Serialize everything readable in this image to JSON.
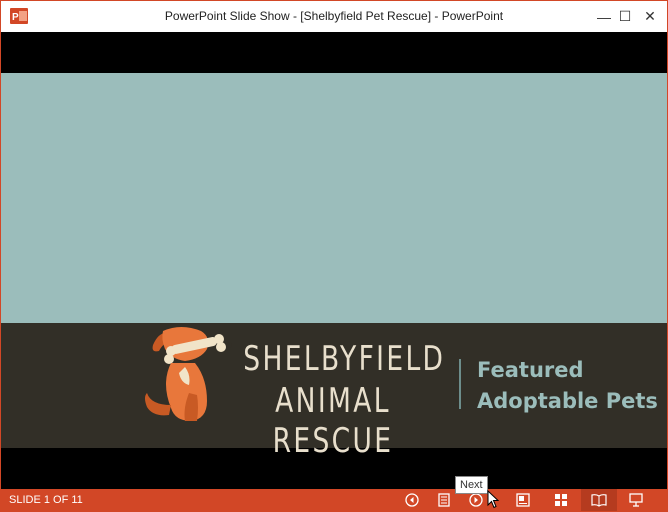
{
  "window": {
    "title": "PowerPoint Slide Show - [Shelbyfield Pet Rescue] - PowerPoint",
    "app_icon_letter": "P",
    "minimize_glyph": "—",
    "maximize_glyph": "☐",
    "close_glyph": "✕"
  },
  "slide": {
    "org_line1": "SHELBYFIELD",
    "org_line2": "ANIMAL RESCUE",
    "tag_line1": "Featured",
    "tag_line2": "Adoptable Pets",
    "colors": {
      "background": "#9bbdbb",
      "band": "#322f27",
      "dog": "#e8773b",
      "org_text": "#e8dfcc",
      "tag_text": "#9bbdbb"
    }
  },
  "statusbar": {
    "slide_counter": "SLIDE 1 OF 11",
    "tooltip": "Next",
    "accent": "#d24726",
    "icons": [
      "previous-icon",
      "notes-icon",
      "next-icon",
      "presenter-view-icon",
      "slide-sorter-icon",
      "reading-view-icon",
      "slideshow-icon"
    ]
  }
}
